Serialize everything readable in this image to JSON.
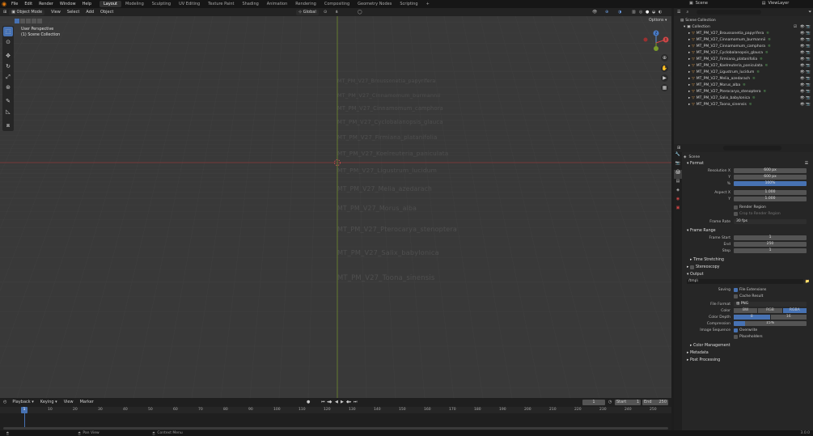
{
  "topbar": {
    "menus": [
      "File",
      "Edit",
      "Render",
      "Window",
      "Help"
    ],
    "workspaces": [
      "Layout",
      "Modeling",
      "Sculpting",
      "UV Editing",
      "Texture Paint",
      "Shading",
      "Animation",
      "Rendering",
      "Compositing",
      "Geometry Nodes",
      "Scripting"
    ],
    "active_workspace": "Layout",
    "add_tab": "+",
    "scene_name": "Scene",
    "view_layer": "ViewLayer"
  },
  "viewport_header": {
    "mode": "Object Mode",
    "menus": [
      "View",
      "Select",
      "Add",
      "Object"
    ],
    "orientation": "Global",
    "options": "Options"
  },
  "viewport": {
    "perspective": "User Perspective",
    "collection": "(1) Scene Collection",
    "gizmo_axes": [
      "Z",
      "Y",
      "X"
    ],
    "objects": [
      "MT_PM_V27_Broussonetia_papyrifera",
      "MT_PM_V27_Cinnamomum_burmannii",
      "MT_PM_V27_Cinnamomum_camphora",
      "MT_PM_V27_Cyclobalanopsis_glauca",
      "MT_PM_V27_Firmiana_platanifolia",
      "MT_PM_V27_Koelreuteria_paniculata",
      "MT_PM_V27_Ligustrum_lucidum",
      "MT_PM_V27_Melia_azedarach",
      "MT_PM_V27_Morus_alba",
      "MT_PM_V27_Pterocarya_stenoptera",
      "MT_PM_V27_Salix_babylonica",
      "MT_PM_V27_Toona_sinensis"
    ]
  },
  "timeline": {
    "menus": [
      "Playback",
      "Keying",
      "View",
      "Marker"
    ],
    "current_frame": "1",
    "start_label": "Start",
    "start": "1",
    "end_label": "End",
    "end": "250",
    "ticks": [
      "1",
      "10",
      "20",
      "30",
      "40",
      "50",
      "60",
      "70",
      "80",
      "90",
      "100",
      "110",
      "120",
      "130",
      "140",
      "150",
      "160",
      "170",
      "180",
      "190",
      "200",
      "210",
      "220",
      "230",
      "240",
      "250"
    ]
  },
  "statusbar": {
    "pan_view": "Pan View",
    "context_menu": "Context Menu",
    "version": "3.0.0"
  },
  "outliner": {
    "root": "Scene Collection",
    "collection": "Collection",
    "items": [
      "MT_PM_V27_Broussonetia_papyrifera",
      "MT_PM_V27_Cinnamomum_burmannii",
      "MT_PM_V27_Cinnamomum_camphora",
      "MT_PM_V27_Cyclobalanopsis_glauca",
      "MT_PM_V27_Firmiana_platanifolia",
      "MT_PM_V27_Koelreuteria_paniculata",
      "MT_PM_V27_Ligustrum_lucidum",
      "MT_PM_V27_Melia_azedarach",
      "MT_PM_V27_Morus_alba",
      "MT_PM_V27_Pterocarya_stenoptera",
      "MT_PM_V27_Salix_babylonica",
      "MT_PM_V27_Toona_sinensis"
    ]
  },
  "properties": {
    "scene": "Scene",
    "format_section": "Format",
    "res_x_label": "Resolution X",
    "res_x": "600 px",
    "res_y_label": "Y",
    "res_y": "600 px",
    "res_pct_label": "%",
    "res_pct": "100%",
    "aspect_x_label": "Aspect X",
    "aspect_x": "1.000",
    "aspect_y_label": "Y",
    "aspect_y": "1.000",
    "render_region": "Render Region",
    "crop_region": "Crop to Render Region",
    "frame_rate_label": "Frame Rate",
    "frame_rate": "30 fps",
    "frame_range_section": "Frame Range",
    "frame_start_label": "Frame Start",
    "frame_start": "1",
    "end_label": "End",
    "end": "250",
    "step_label": "Step",
    "step": "1",
    "time_stretching": "Time Stretching",
    "stereoscopy": "Stereoscopy",
    "output_section": "Output",
    "output_path": "/tmp\\",
    "saving_label": "Saving",
    "file_extensions": "File Extensions",
    "cache_result": "Cache Result",
    "file_format_label": "File Format",
    "file_format": "PNG",
    "color_label": "Color",
    "color_options": [
      "BW",
      "RGB",
      "RGBA"
    ],
    "color_depth_label": "Color Depth",
    "color_depth_options": [
      "8",
      "16"
    ],
    "compression_label": "Compression",
    "compression": "15%",
    "compression_value": 0.15,
    "image_sequence_label": "Image Sequence",
    "overwrite": "Overwrite",
    "placeholders": "Placeholders",
    "color_management": "Color Management",
    "metadata": "Metadata",
    "post_processing": "Post Processing"
  },
  "colors": {
    "accent": "#4772b3",
    "axis_x": "#8b3a3a",
    "axis_y": "#6f8a2e"
  }
}
